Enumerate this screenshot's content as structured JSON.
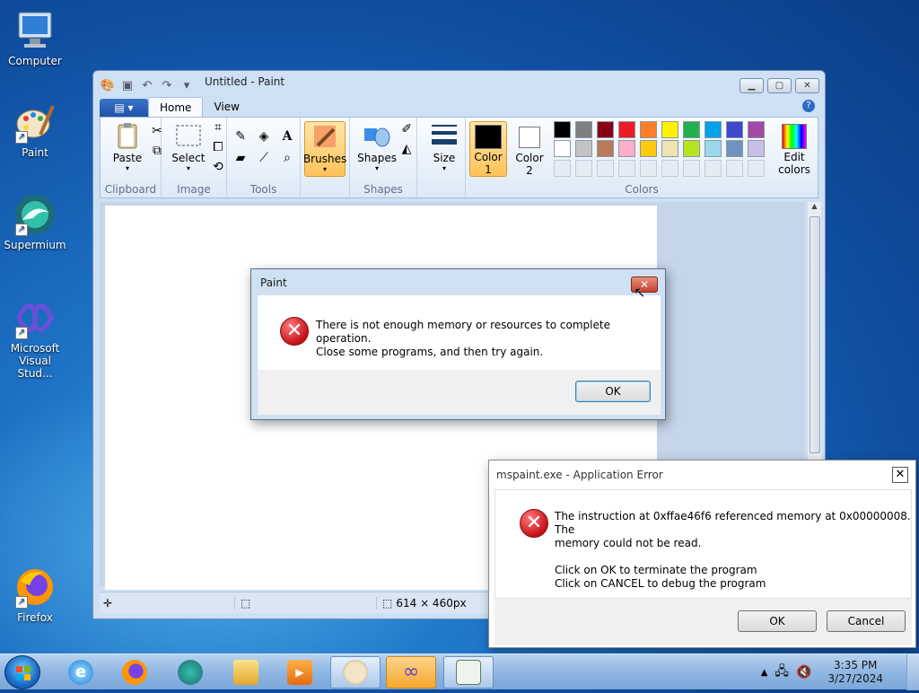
{
  "desktop": {
    "icons": [
      {
        "label": "Computer",
        "icon": "computer-icon"
      },
      {
        "label": "Paint",
        "icon": "paint-icon"
      },
      {
        "label": "Supermium",
        "icon": "supermium-icon"
      },
      {
        "label": "Microsoft Visual Stud...",
        "icon": "visual-studio-icon"
      },
      {
        "label": "Firefox",
        "icon": "firefox-icon"
      }
    ]
  },
  "paint": {
    "title": "Untitled - Paint",
    "tabs": [
      "Home",
      "View"
    ],
    "groups": {
      "clipboard": {
        "label": "Clipboard",
        "paste": "Paste"
      },
      "image": {
        "label": "Image",
        "select": "Select"
      },
      "tools": {
        "label": "Tools",
        "text_tool": "A"
      },
      "brushes": "Brushes",
      "shapes": {
        "label": "Shapes",
        "button": "Shapes"
      },
      "size": "Size",
      "colors": {
        "label": "Colors",
        "color1": [
          "Color",
          "1"
        ],
        "color2": [
          "Color",
          "2"
        ],
        "edit": [
          "Edit",
          "colors"
        ]
      }
    },
    "palette_row1": [
      "#000000",
      "#7f7f7f",
      "#880015",
      "#ed1c24",
      "#ff7f27",
      "#fff200",
      "#22b14c",
      "#00a2e8",
      "#3f48cc",
      "#a349a4"
    ],
    "palette_row2": [
      "#ffffff",
      "#c3c3c3",
      "#b97a57",
      "#ffaec9",
      "#ffc90e",
      "#efe4b0",
      "#b5e61d",
      "#99d9ea",
      "#7092be",
      "#c8bfe7"
    ],
    "status": {
      "size": "614 × 460px"
    }
  },
  "dialog_memory": {
    "title": "Paint",
    "line1": "There is not enough memory or resources to complete operation.",
    "line2": "Close some programs, and then try again.",
    "ok": "OK"
  },
  "dialog_apperror": {
    "title": "mspaint.exe - Application Error",
    "line1": "The instruction at 0xffae46f6 referenced memory at 0x00000008. The",
    "line2": "memory could not be read.",
    "line3": "Click on OK to terminate the program",
    "line4": "Click on CANCEL to debug the program",
    "ok": "OK",
    "cancel": "Cancel"
  },
  "taskbar": {
    "items": [
      "internet-explorer-icon",
      "firefox-icon",
      "supermium-icon",
      "file-explorer-icon",
      "media-player-icon",
      "paint-icon",
      "visual-studio-icon",
      "app-window-icon"
    ],
    "time": "3:35 PM",
    "date": "3/27/2024"
  }
}
